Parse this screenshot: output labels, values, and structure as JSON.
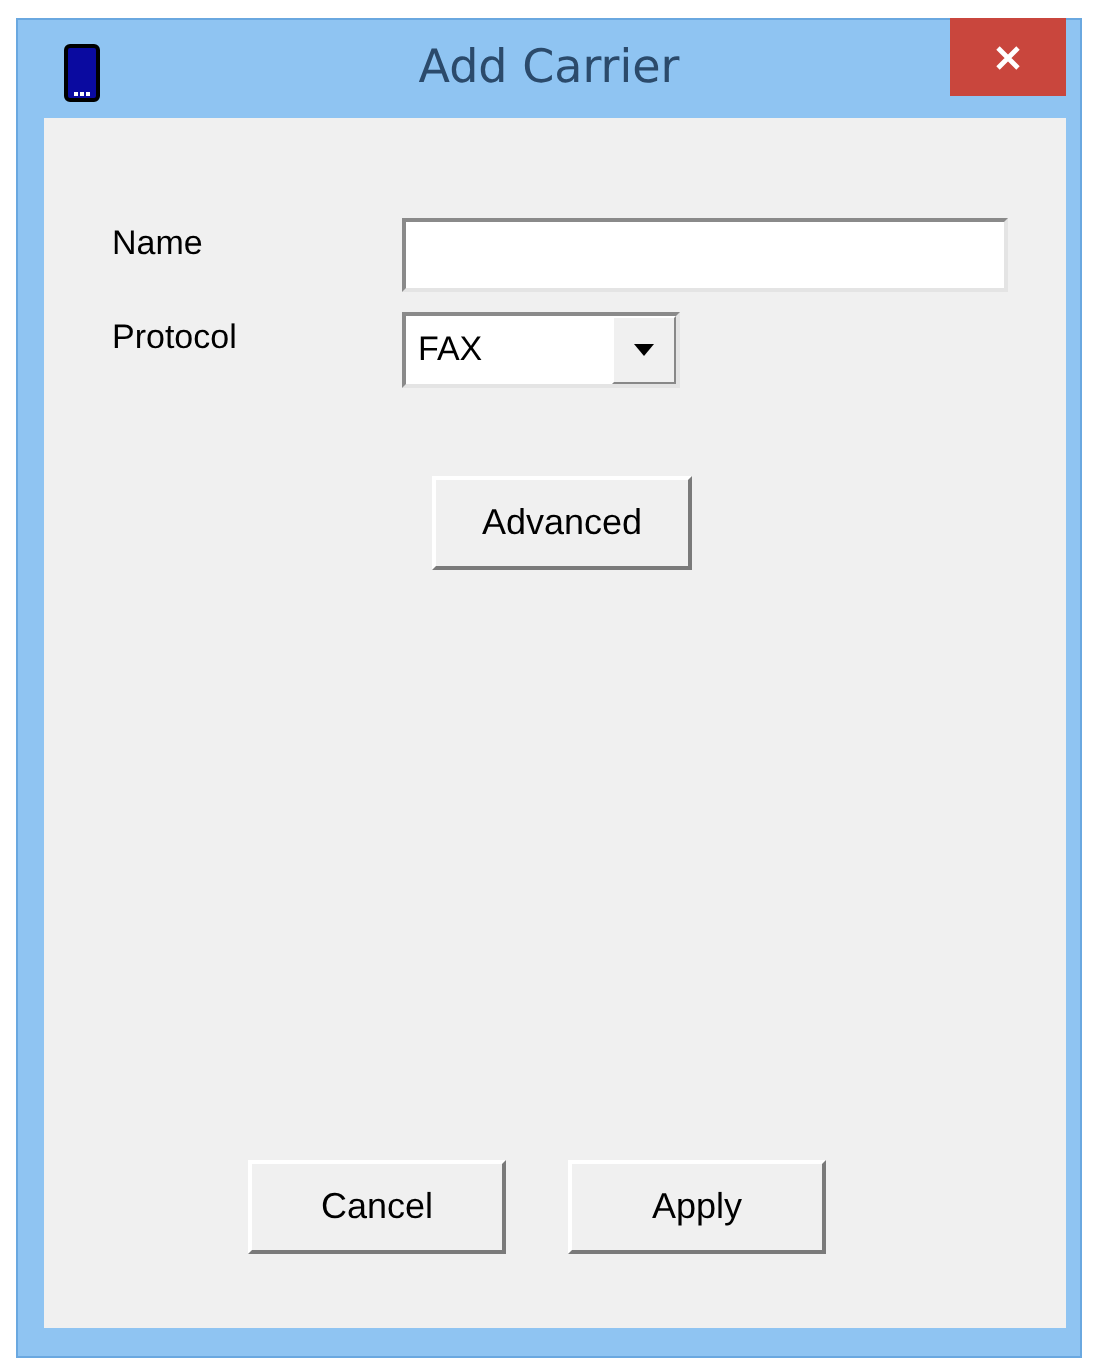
{
  "window": {
    "title": "Add Carrier"
  },
  "form": {
    "name": {
      "label": "Name"
    },
    "protocol": {
      "label": "Protocol",
      "value": "FAX"
    }
  },
  "advanced_button": "Advanced",
  "buttons": [
    "Cancel",
    "Apply"
  ]
}
